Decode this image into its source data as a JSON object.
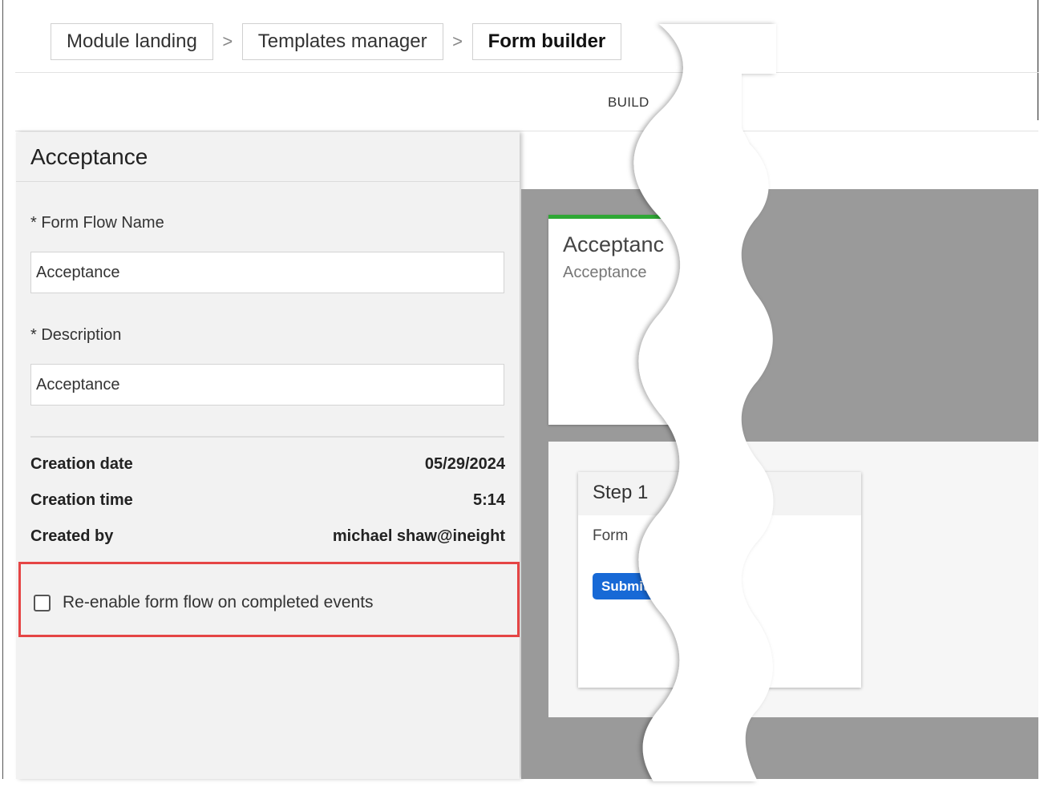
{
  "breadcrumb": {
    "items": [
      "Module landing",
      "Templates manager",
      "Form builder"
    ],
    "separator": ">"
  },
  "tabs": {
    "build_label": "BUILD"
  },
  "panel": {
    "title": "Acceptance",
    "form_flow_name": {
      "label": "* Form Flow Name",
      "value": "Acceptance"
    },
    "description": {
      "label": "* Description",
      "value": "Acceptance"
    },
    "meta": [
      {
        "label": "Creation date",
        "value": "05/29/2024"
      },
      {
        "label": "Creation time",
        "value": "5:14"
      },
      {
        "label": "Created by",
        "value": "michael shaw@ineight"
      }
    ],
    "reenable_checkbox": {
      "label": "Re-enable form flow on completed events",
      "checked": false
    }
  },
  "canvas": {
    "card": {
      "title": "Acceptanc",
      "subtitle": "Acceptance",
      "accent_color": "#2fa835"
    },
    "step": {
      "title": "Step 1",
      "text": "Form",
      "button_label": "Submit t",
      "button_color": "#1769d6"
    }
  },
  "highlight_color": "#e54545"
}
